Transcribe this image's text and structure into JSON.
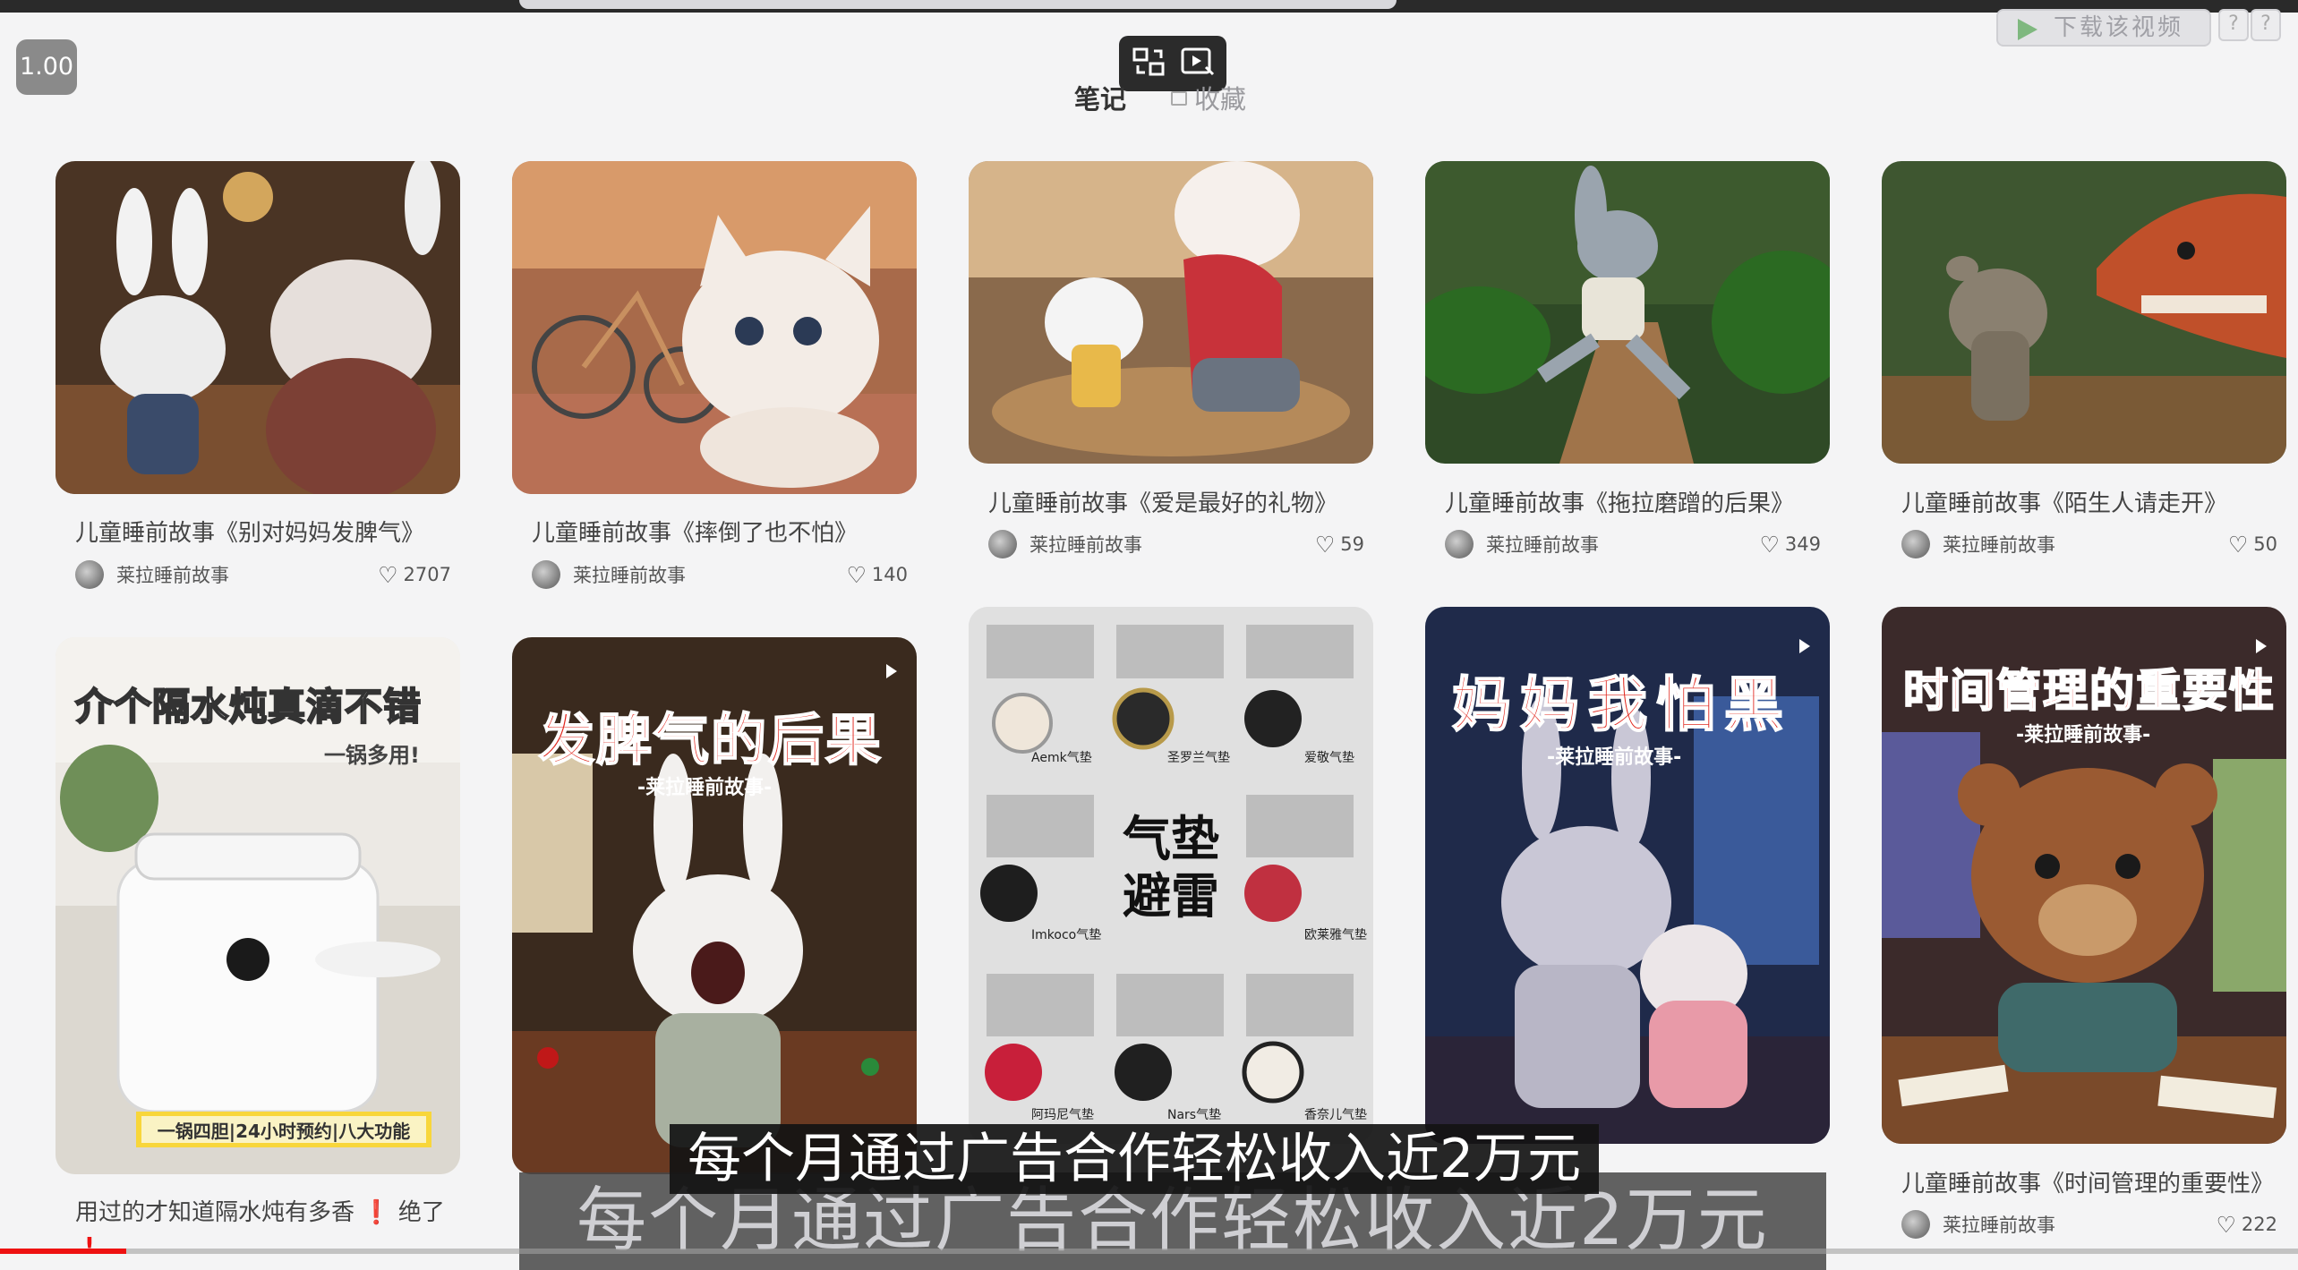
{
  "player": {
    "speed": "1.00",
    "download_label": "下载该视频",
    "help_label": "?",
    "progress": 0.055
  },
  "tabs": [
    {
      "label": "笔记"
    },
    {
      "label": "收藏"
    }
  ],
  "cards": [
    {
      "title": "儿童睡前故事《别对妈妈发脾气》",
      "author": "莱拉睡前故事",
      "likes": "2707"
    },
    {
      "title": "儿童睡前故事《摔倒了也不怕》",
      "author": "莱拉睡前故事",
      "likes": "140"
    },
    {
      "title": "儿童睡前故事《爱是最好的礼物》",
      "author": "莱拉睡前故事",
      "likes": "59"
    },
    {
      "title": "儿童睡前故事《拖拉磨蹭的后果》",
      "author": "莱拉睡前故事",
      "likes": "349"
    },
    {
      "title": "儿童睡前故事《陌生人请走开》",
      "author": "莱拉睡前故事",
      "likes": "50"
    },
    {
      "title": "用过的才知道隔水炖有多香",
      "title_mark": "❗",
      "title_suffix": "绝了",
      "poster_title": "介个隔水炖真滴不错",
      "poster_sub": "一锅多用!",
      "poster_bar": "一锅四胆|24小时预约|八大功能"
    },
    {
      "poster_title": "发脾气的后果",
      "poster_sub": "-莱拉睡前故事-"
    },
    {
      "poster_title": "气垫避雷",
      "poster_title_line1": "气垫",
      "poster_title_line2": "避雷",
      "labels": [
        "Aemk气垫",
        "圣罗兰气垫",
        "爱敬气垫",
        "Imkoco气垫",
        "欧莱雅气垫",
        "阿玛尼气垫",
        "Nars气垫",
        "香奈儿气垫"
      ]
    },
    {
      "poster_title": "妈妈我怕黑",
      "poster_sub": "-莱拉睡前故事-"
    },
    {
      "title": "儿童睡前故事《时间管理的重要性》",
      "author": "莱拉睡前故事",
      "likes": "222",
      "poster_title": "时间管理的重要性",
      "poster_sub": "-莱拉睡前故事-"
    }
  ],
  "subtitles": {
    "main": "每个月通过广告合作轻松收入近2万元",
    "echo": "每个月通过广告合作轻松收入近2万元"
  },
  "colors": {
    "poster_red": "#e0241b",
    "progress": "#ee1111",
    "background": "#f4f4f5"
  }
}
